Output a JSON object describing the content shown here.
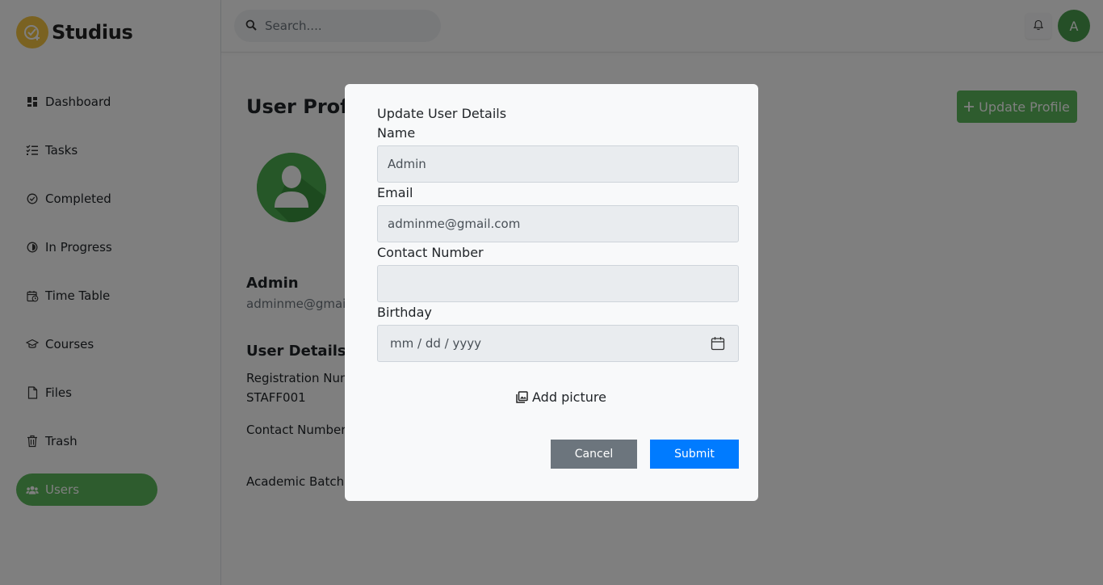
{
  "app": {
    "name": "Studius"
  },
  "search": {
    "placeholder": "Search...."
  },
  "header": {
    "avatar_initial": "A"
  },
  "sidebar": {
    "items": [
      {
        "label": "Dashboard",
        "icon": "dashboard-icon"
      },
      {
        "label": "Tasks",
        "icon": "tasks-icon"
      },
      {
        "label": "Completed",
        "icon": "check-circle-icon"
      },
      {
        "label": "In Progress",
        "icon": "progress-icon"
      },
      {
        "label": "Time Table",
        "icon": "calendar-clock-icon"
      },
      {
        "label": "Courses",
        "icon": "graduation-cap-icon"
      },
      {
        "label": "Files",
        "icon": "file-icon"
      },
      {
        "label": "Trash",
        "icon": "trash-icon"
      },
      {
        "label": "Users",
        "icon": "users-icon",
        "active": true
      }
    ]
  },
  "profile": {
    "title": "User Profile",
    "update_button": "Update Profile",
    "name": "Admin",
    "email": "adminme@gmail.com",
    "details_title": "User Details",
    "registration_label": "Registration Number:",
    "registration_value": "STAFF001",
    "contact_label": "Contact Number:",
    "batch_label": "Academic Batch:"
  },
  "modal": {
    "title": "Update User Details",
    "name_label": "Name",
    "name_value": "Admin",
    "email_label": "Email",
    "email_value": "adminme@gmail.com",
    "contact_label": "Contact Number",
    "contact_value": "",
    "birthday_label": "Birthday",
    "birthday_placeholder": "mm / dd / yyyy",
    "add_picture": "Add picture",
    "cancel": "Cancel",
    "submit": "Submit"
  },
  "colors": {
    "brand_yellow": "#f5c542",
    "active_green": "#5cb85c",
    "submit_blue": "#007bff",
    "cancel_gray": "#6c757d"
  }
}
